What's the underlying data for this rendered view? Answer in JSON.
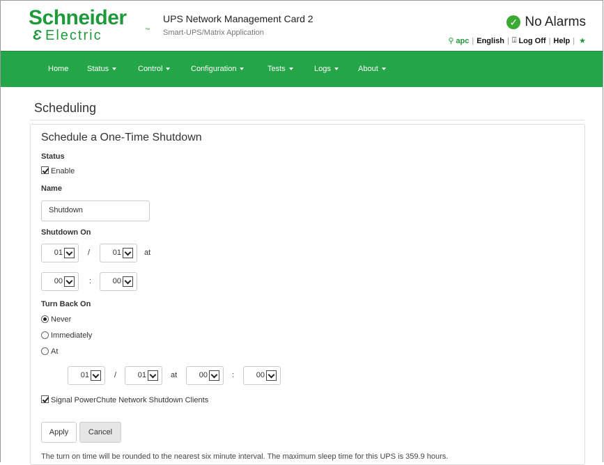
{
  "header": {
    "logo": {
      "brand": "Schneider",
      "sub": "Electric"
    },
    "app_title": "UPS Network Management Card 2",
    "app_subtitle": "Smart-UPS/Matrix Application",
    "alarm_status": "No Alarms",
    "links": {
      "user": "apc",
      "language": "English",
      "logoff": "Log Off",
      "help": "Help"
    }
  },
  "nav": {
    "items": [
      {
        "label": "Home",
        "dropdown": false
      },
      {
        "label": "Status",
        "dropdown": true
      },
      {
        "label": "Control",
        "dropdown": true
      },
      {
        "label": "Configuration",
        "dropdown": true
      },
      {
        "label": "Tests",
        "dropdown": true
      },
      {
        "label": "Logs",
        "dropdown": true
      },
      {
        "label": "About",
        "dropdown": true
      }
    ]
  },
  "page": {
    "title": "Scheduling"
  },
  "form": {
    "section_title": "Schedule a One-Time Shutdown",
    "status_label": "Status",
    "enable_label": "Enable",
    "enable_checked": true,
    "name_label": "Name",
    "name_value": "Shutdown",
    "shutdown_on_label": "Shutdown On",
    "shutdown_month": "01",
    "shutdown_day": "01",
    "shutdown_hour": "00",
    "shutdown_minute": "00",
    "date_sep": "/",
    "time_sep": ":",
    "at_label": "at",
    "turn_back_on_label": "Turn Back On",
    "options": [
      "Never",
      "Immediately",
      "At"
    ],
    "selected_option": "Never",
    "back_month": "01",
    "back_day": "01",
    "back_hour": "00",
    "back_minute": "00",
    "signal_label": "Signal PowerChute Network Shutdown Clients",
    "signal_checked": true,
    "apply_label": "Apply",
    "cancel_label": "Cancel",
    "note": "The turn on time will be rounded to the nearest six minute interval. The maximum sleep time for this UPS is 359.9 hours."
  },
  "colors": {
    "brand_green": "#1e9a3b",
    "nav_green": "#24a547",
    "alarm_green": "#3aaa35"
  }
}
